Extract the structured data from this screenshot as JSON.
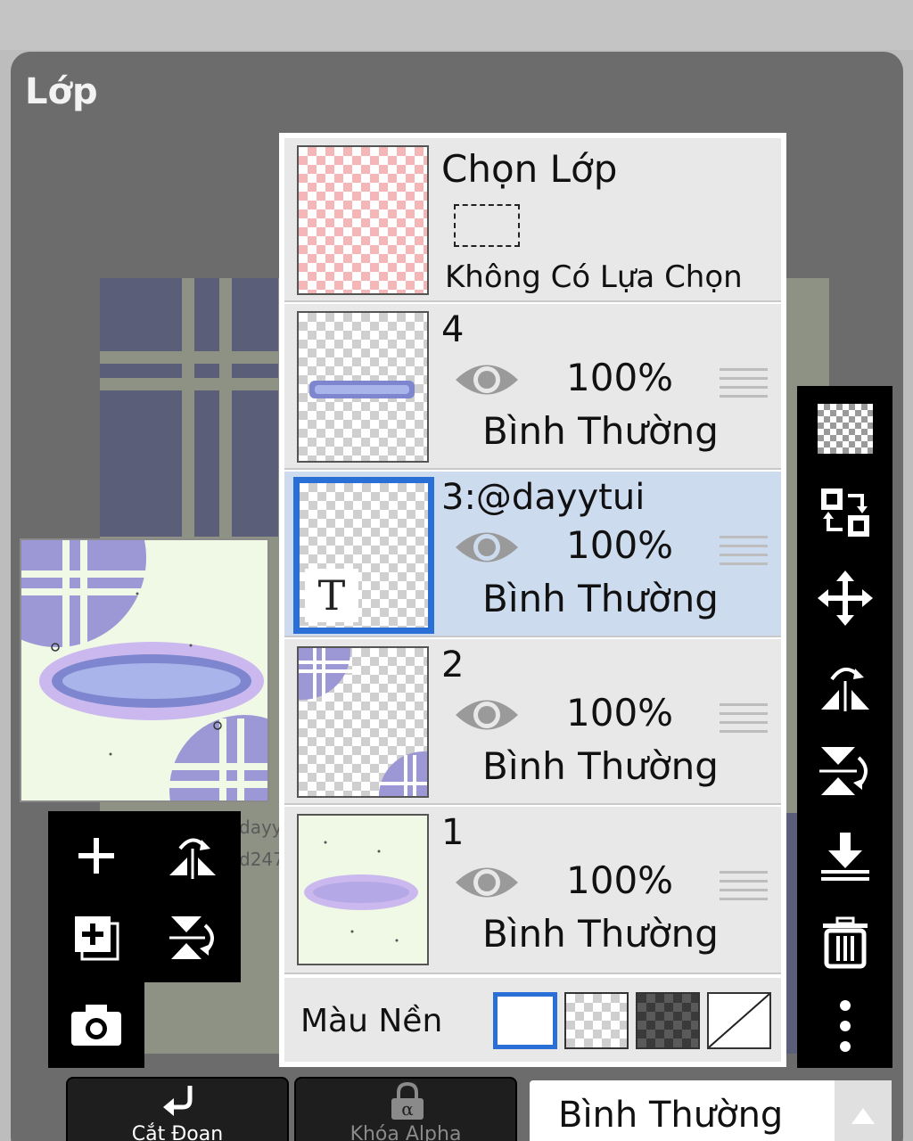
{
  "panel": {
    "title": "Lớp"
  },
  "selection_layer": {
    "title": "Chọn Lớp",
    "status": "Không Có Lựa Chọn"
  },
  "layers": [
    {
      "name": "4",
      "opacity": "100%",
      "blend": "Bình Thường",
      "selected": false
    },
    {
      "name": "3:@dayytui",
      "opacity": "100%",
      "blend": "Bình Thường",
      "selected": true,
      "thumb_glyph": "T"
    },
    {
      "name": "2",
      "opacity": "100%",
      "blend": "Bình Thường",
      "selected": false
    },
    {
      "name": "1",
      "opacity": "100%",
      "blend": "Bình Thường",
      "selected": false
    }
  ],
  "background": {
    "label": "Màu Nền",
    "options": [
      "white",
      "transparent",
      "dark-checker",
      "none"
    ],
    "selected": "white"
  },
  "canvas_ghost": {
    "line1": "dayyt",
    "line2": "d247"
  },
  "bottom_bar": {
    "clip_label": "Cắt Đoạn",
    "alpha_lock_label": "Khóa Alpha",
    "blend_mode": "Bình Thường"
  },
  "colors": {
    "accent": "#2a6fd6",
    "selected_row": "#cddbef",
    "panel": "#6c6c6c",
    "toolbar": "#000000"
  },
  "icons": {
    "left_tools": [
      "plus-icon",
      "flip-horizontal-icon",
      "add-layer-icon",
      "flip-vertical-icon",
      "camera-icon"
    ],
    "right_tools": [
      "checker-icon",
      "swap-layer-icon",
      "move-icon",
      "flip-horizontal-icon",
      "flip-vertical-icon",
      "merge-down-icon",
      "trash-icon",
      "more-icon"
    ]
  }
}
